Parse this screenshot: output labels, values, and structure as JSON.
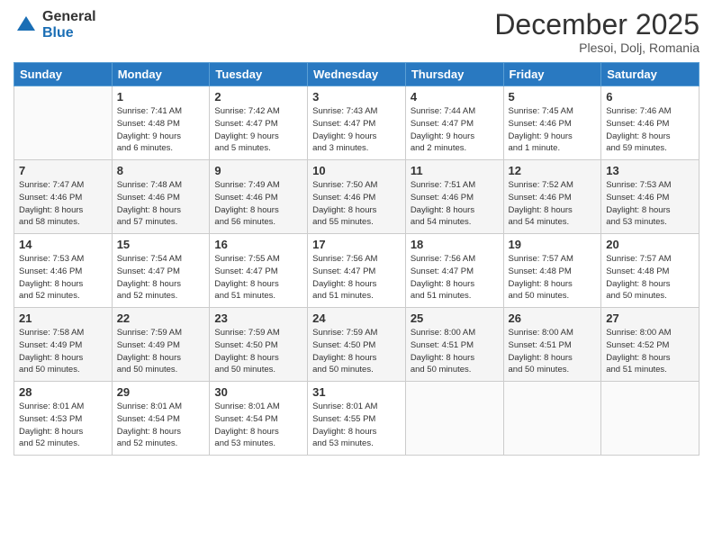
{
  "logo": {
    "general": "General",
    "blue": "Blue"
  },
  "header": {
    "month": "December 2025",
    "location": "Plesoi, Dolj, Romania"
  },
  "weekdays": [
    "Sunday",
    "Monday",
    "Tuesday",
    "Wednesday",
    "Thursday",
    "Friday",
    "Saturday"
  ],
  "weeks": [
    [
      {
        "day": "",
        "info": ""
      },
      {
        "day": "1",
        "info": "Sunrise: 7:41 AM\nSunset: 4:48 PM\nDaylight: 9 hours\nand 6 minutes."
      },
      {
        "day": "2",
        "info": "Sunrise: 7:42 AM\nSunset: 4:47 PM\nDaylight: 9 hours\nand 5 minutes."
      },
      {
        "day": "3",
        "info": "Sunrise: 7:43 AM\nSunset: 4:47 PM\nDaylight: 9 hours\nand 3 minutes."
      },
      {
        "day": "4",
        "info": "Sunrise: 7:44 AM\nSunset: 4:47 PM\nDaylight: 9 hours\nand 2 minutes."
      },
      {
        "day": "5",
        "info": "Sunrise: 7:45 AM\nSunset: 4:46 PM\nDaylight: 9 hours\nand 1 minute."
      },
      {
        "day": "6",
        "info": "Sunrise: 7:46 AM\nSunset: 4:46 PM\nDaylight: 8 hours\nand 59 minutes."
      }
    ],
    [
      {
        "day": "7",
        "info": "Sunrise: 7:47 AM\nSunset: 4:46 PM\nDaylight: 8 hours\nand 58 minutes."
      },
      {
        "day": "8",
        "info": "Sunrise: 7:48 AM\nSunset: 4:46 PM\nDaylight: 8 hours\nand 57 minutes."
      },
      {
        "day": "9",
        "info": "Sunrise: 7:49 AM\nSunset: 4:46 PM\nDaylight: 8 hours\nand 56 minutes."
      },
      {
        "day": "10",
        "info": "Sunrise: 7:50 AM\nSunset: 4:46 PM\nDaylight: 8 hours\nand 55 minutes."
      },
      {
        "day": "11",
        "info": "Sunrise: 7:51 AM\nSunset: 4:46 PM\nDaylight: 8 hours\nand 54 minutes."
      },
      {
        "day": "12",
        "info": "Sunrise: 7:52 AM\nSunset: 4:46 PM\nDaylight: 8 hours\nand 54 minutes."
      },
      {
        "day": "13",
        "info": "Sunrise: 7:53 AM\nSunset: 4:46 PM\nDaylight: 8 hours\nand 53 minutes."
      }
    ],
    [
      {
        "day": "14",
        "info": "Sunrise: 7:53 AM\nSunset: 4:46 PM\nDaylight: 8 hours\nand 52 minutes."
      },
      {
        "day": "15",
        "info": "Sunrise: 7:54 AM\nSunset: 4:47 PM\nDaylight: 8 hours\nand 52 minutes."
      },
      {
        "day": "16",
        "info": "Sunrise: 7:55 AM\nSunset: 4:47 PM\nDaylight: 8 hours\nand 51 minutes."
      },
      {
        "day": "17",
        "info": "Sunrise: 7:56 AM\nSunset: 4:47 PM\nDaylight: 8 hours\nand 51 minutes."
      },
      {
        "day": "18",
        "info": "Sunrise: 7:56 AM\nSunset: 4:47 PM\nDaylight: 8 hours\nand 51 minutes."
      },
      {
        "day": "19",
        "info": "Sunrise: 7:57 AM\nSunset: 4:48 PM\nDaylight: 8 hours\nand 50 minutes."
      },
      {
        "day": "20",
        "info": "Sunrise: 7:57 AM\nSunset: 4:48 PM\nDaylight: 8 hours\nand 50 minutes."
      }
    ],
    [
      {
        "day": "21",
        "info": "Sunrise: 7:58 AM\nSunset: 4:49 PM\nDaylight: 8 hours\nand 50 minutes."
      },
      {
        "day": "22",
        "info": "Sunrise: 7:59 AM\nSunset: 4:49 PM\nDaylight: 8 hours\nand 50 minutes."
      },
      {
        "day": "23",
        "info": "Sunrise: 7:59 AM\nSunset: 4:50 PM\nDaylight: 8 hours\nand 50 minutes."
      },
      {
        "day": "24",
        "info": "Sunrise: 7:59 AM\nSunset: 4:50 PM\nDaylight: 8 hours\nand 50 minutes."
      },
      {
        "day": "25",
        "info": "Sunrise: 8:00 AM\nSunset: 4:51 PM\nDaylight: 8 hours\nand 50 minutes."
      },
      {
        "day": "26",
        "info": "Sunrise: 8:00 AM\nSunset: 4:51 PM\nDaylight: 8 hours\nand 50 minutes."
      },
      {
        "day": "27",
        "info": "Sunrise: 8:00 AM\nSunset: 4:52 PM\nDaylight: 8 hours\nand 51 minutes."
      }
    ],
    [
      {
        "day": "28",
        "info": "Sunrise: 8:01 AM\nSunset: 4:53 PM\nDaylight: 8 hours\nand 52 minutes."
      },
      {
        "day": "29",
        "info": "Sunrise: 8:01 AM\nSunset: 4:54 PM\nDaylight: 8 hours\nand 52 minutes."
      },
      {
        "day": "30",
        "info": "Sunrise: 8:01 AM\nSunset: 4:54 PM\nDaylight: 8 hours\nand 53 minutes."
      },
      {
        "day": "31",
        "info": "Sunrise: 8:01 AM\nSunset: 4:55 PM\nDaylight: 8 hours\nand 53 minutes."
      },
      {
        "day": "",
        "info": ""
      },
      {
        "day": "",
        "info": ""
      },
      {
        "day": "",
        "info": ""
      }
    ]
  ]
}
